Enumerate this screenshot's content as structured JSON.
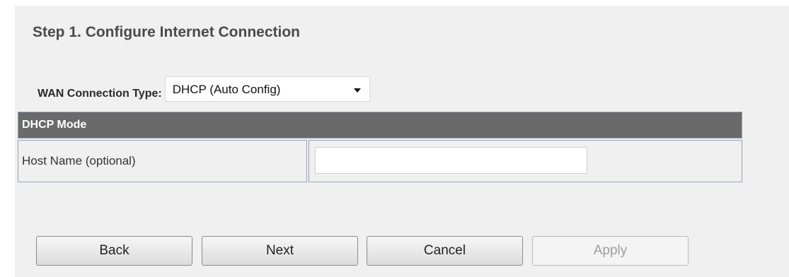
{
  "page_title": "Step 1. Configure Internet Connection",
  "wan": {
    "label": "WAN Connection Type:",
    "selected": "DHCP (Auto Config)"
  },
  "dhcp_table": {
    "header": "DHCP Mode",
    "host_name_label": "Host Name (optional)",
    "host_name_value": "",
    "host_name_placeholder": ""
  },
  "buttons": {
    "back": "Back",
    "next": "Next",
    "cancel": "Cancel",
    "apply": "Apply"
  },
  "colors": {
    "panel_bg": "#f0f0f0",
    "table_header_bg": "#6a6a6a",
    "table_border": "#9aa3b8",
    "title": "#4a4a4a",
    "disabled_text": "#9e9e9e"
  }
}
